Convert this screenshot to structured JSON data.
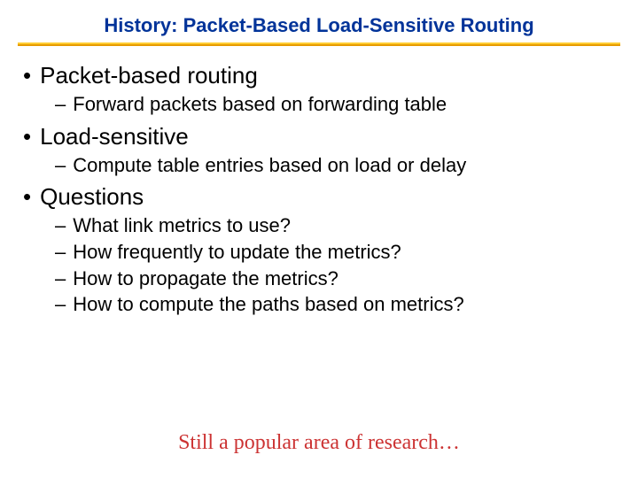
{
  "title": "History: Packet-Based Load-Sensitive Routing",
  "bullets": [
    {
      "text": "Packet-based routing",
      "sub": [
        "Forward packets based on forwarding table"
      ]
    },
    {
      "text": "Load-sensitive",
      "sub": [
        "Compute table entries based on load or delay"
      ]
    },
    {
      "text": "Questions",
      "sub": [
        "What link metrics to use?",
        "How frequently to update the metrics?",
        "How to propagate the metrics?",
        "How to compute the paths based on metrics?"
      ]
    }
  ],
  "footer": "Still a popular area of research…",
  "glyphs": {
    "b1": "•",
    "b2": "–"
  }
}
